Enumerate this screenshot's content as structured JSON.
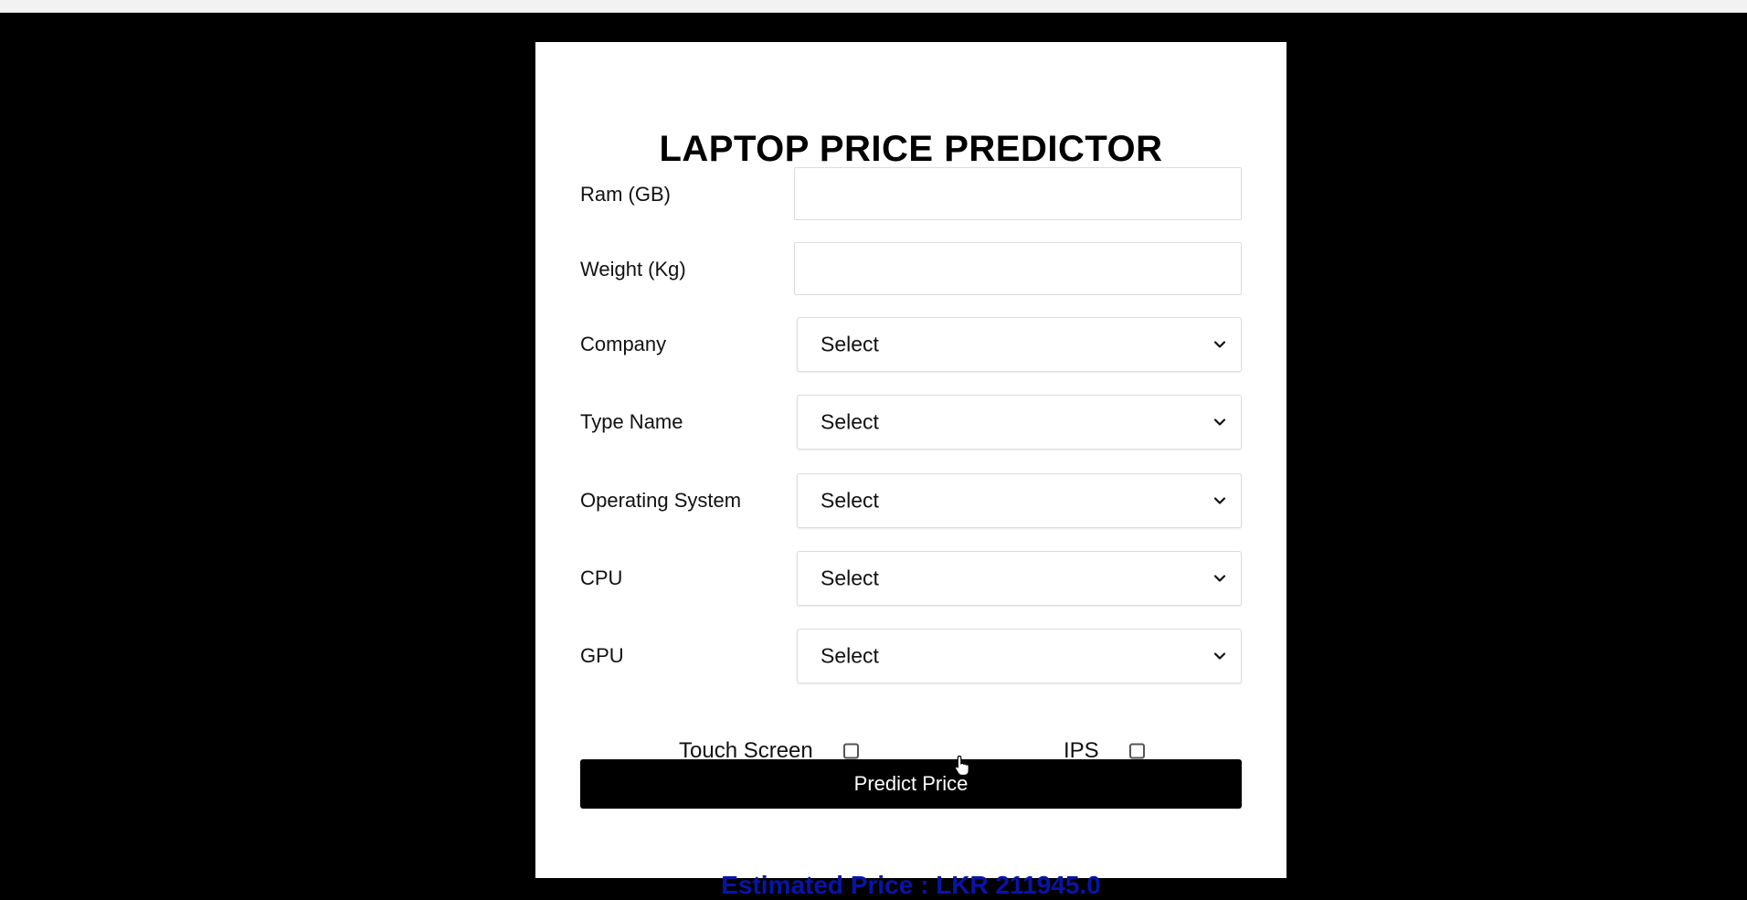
{
  "page": {
    "title": "LAPTOP PRICE PREDICTOR"
  },
  "form": {
    "ram": {
      "label": "Ram (GB)",
      "value": ""
    },
    "weight": {
      "label": "Weight (Kg)",
      "value": ""
    },
    "company": {
      "label": "Company",
      "selected": "Select"
    },
    "type_name": {
      "label": "Type Name",
      "selected": "Select"
    },
    "operating_system": {
      "label": "Operating System",
      "selected": "Select"
    },
    "cpu": {
      "label": "CPU",
      "selected": "Select"
    },
    "gpu": {
      "label": "GPU",
      "selected": "Select"
    },
    "touch_screen": {
      "label": "Touch Screen",
      "checked": false
    },
    "ips": {
      "label": "IPS",
      "checked": false
    },
    "predict_button_label": "Predict Price"
  },
  "result": {
    "text": "Estimated Price : LKR 211945.0"
  },
  "colors": {
    "background": "#000000",
    "card": "#ffffff",
    "button": "#000000",
    "result_text": "#0a14a8"
  },
  "icons": {
    "select_arrow": "chevron-down-icon",
    "pointer": "hand-pointer-icon"
  }
}
